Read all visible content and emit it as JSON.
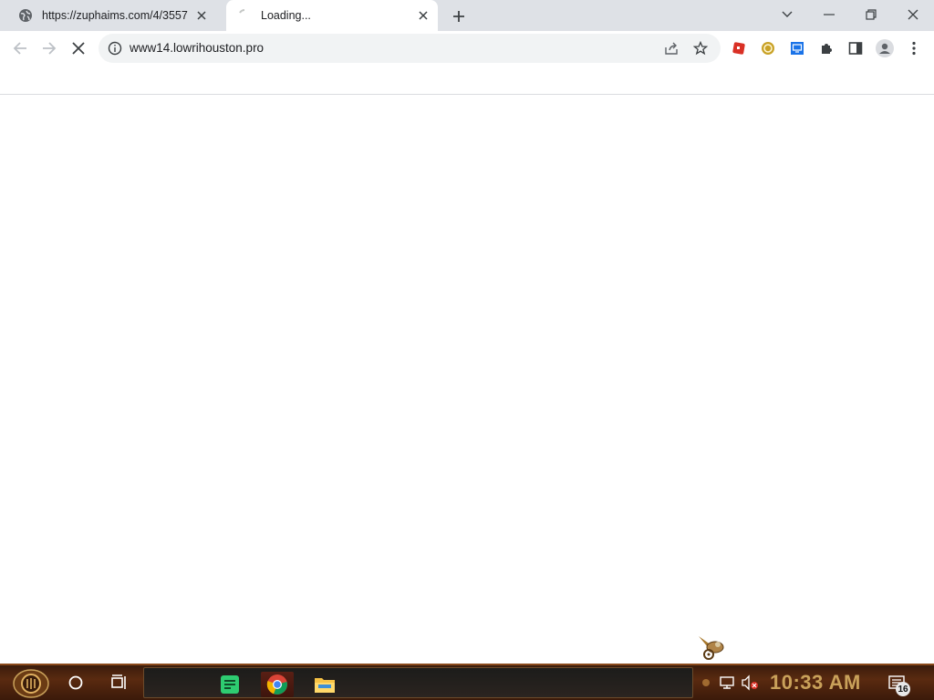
{
  "browser": {
    "tabs": [
      {
        "title": "https://zuphaims.com/4/3557",
        "favicon": "globe-icon",
        "active": false
      },
      {
        "title": "Loading...",
        "favicon": "loading-spinner-icon",
        "active": true
      }
    ],
    "address_bar": {
      "url": "www14.lowrihouston.pro"
    },
    "toolbar_icons": [
      "back-arrow-icon",
      "forward-arrow-icon",
      "stop-loading-icon",
      "site-info-icon",
      "share-icon",
      "bookmark-star-icon"
    ],
    "extensions": [
      "red-cube-extension-icon",
      "gold-coin-extension-icon",
      "blue-screen-extension-icon",
      "puzzle-extensions-icon",
      "side-panel-icon",
      "profile-avatar-icon",
      "kebab-menu-icon"
    ]
  },
  "taskbar": {
    "clock": "10:33 AM",
    "notification_count": "16",
    "apps": [
      "notes-app-icon",
      "chrome-icon",
      "file-explorer-icon"
    ]
  },
  "colors": {
    "tabstrip_bg": "#dee1e6",
    "omnibox_bg": "#f1f3f4",
    "taskbar_accent": "#c9a15a"
  }
}
